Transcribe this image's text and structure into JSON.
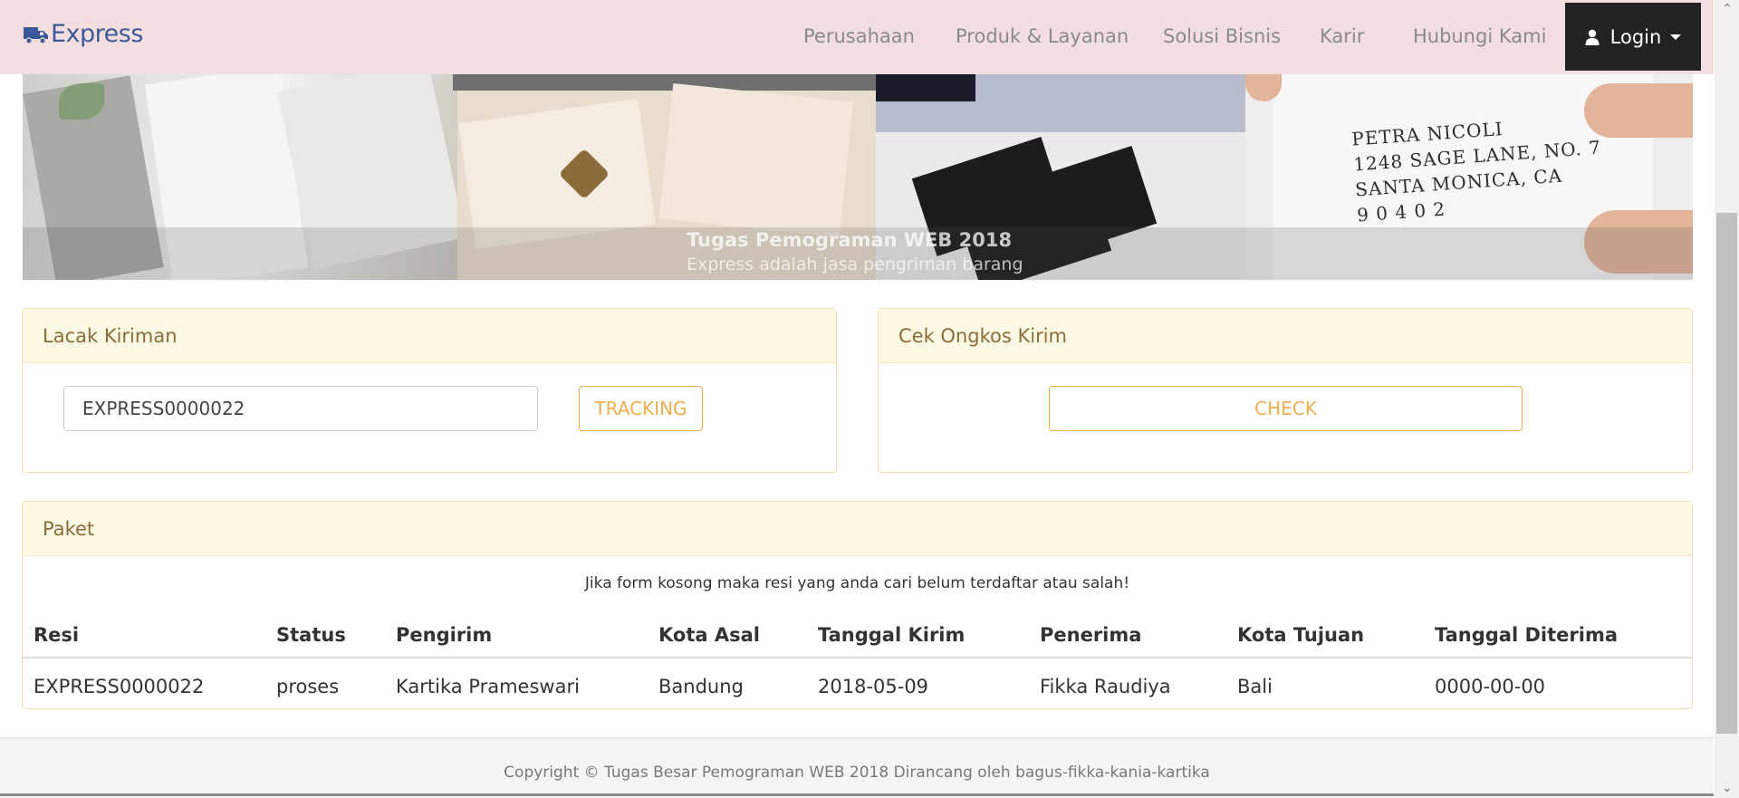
{
  "brand": {
    "name": "Express",
    "icon": "truck-icon",
    "color": "#3b5998"
  },
  "nav": {
    "items": [
      "Perusahaan",
      "Produk & Layanan",
      "Solusi Bisnis",
      "Karir",
      "Hubungi Kami"
    ],
    "login_label": "Login"
  },
  "banner": {
    "heading": "Tugas Pemograman WEB 2018",
    "subheading": "Express adalah jasa pengriman barang",
    "address_lines": [
      "PETRA NICOLI",
      "1248 SAGE LANE, NO. 7",
      "SANTA MONICA, CA",
      "9 0 4 0 2"
    ]
  },
  "tracking": {
    "title": "Lacak Kiriman",
    "input_value": "EXPRESS0000022",
    "button_label": "TRACKING"
  },
  "cost": {
    "title": "Cek Ongkos Kirim",
    "button_label": "CHECK"
  },
  "paket": {
    "title": "Paket",
    "notice": "Jika form kosong maka resi yang anda cari belum terdaftar atau salah!",
    "columns": [
      "Resi",
      "Status",
      "Pengirim",
      "Kota Asal",
      "Tanggal Kirim",
      "Penerima",
      "Kota Tujuan",
      "Tanggal Diterima"
    ],
    "rows": [
      [
        "EXPRESS0000022",
        "proses",
        "Kartika Prameswari",
        "Bandung",
        "2018-05-09",
        "Fikka Raudiya",
        "Bali",
        "0000-00-00"
      ]
    ]
  },
  "footer": {
    "text": "Copyright © Tugas Besar Pemograman WEB 2018 Dirancang oleh bagus-fikka-kania-kartika"
  },
  "colors": {
    "navbar_bg": "#f2dede",
    "login_bg": "#222222",
    "panel_head_bg": "#fcf8e3",
    "panel_head_text": "#8a6d3b",
    "accent_orange": "#f0ad4e"
  }
}
